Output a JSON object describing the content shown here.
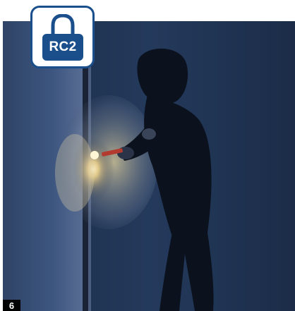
{
  "badge": {
    "label": "RC2",
    "icon": "padlock-icon",
    "color": "#1b4f8c"
  },
  "photo": {
    "subject": "burglar-with-flashlight-at-door"
  },
  "page_number": "6"
}
